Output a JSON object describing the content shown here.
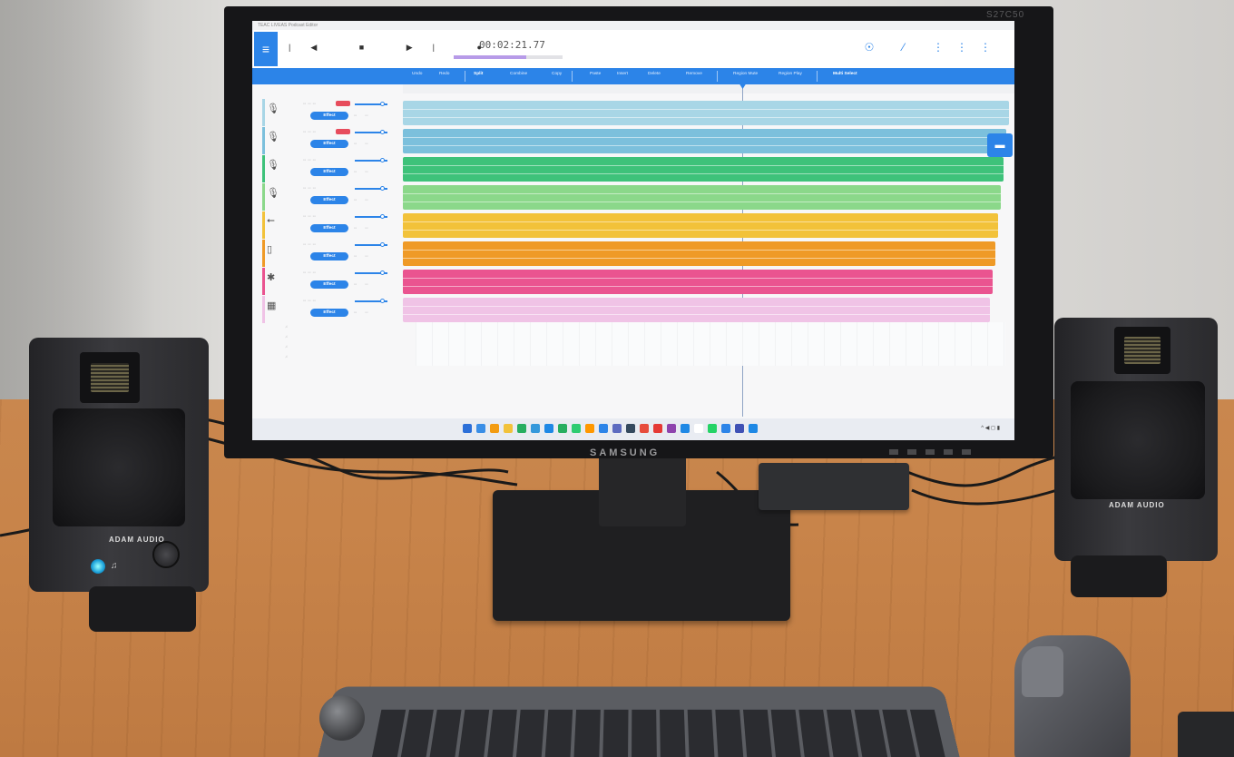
{
  "app": {
    "window_title": "TEAC LIVEAS Podcast Editor",
    "timecode": "00:02:21.77",
    "menu_glyph": "≡",
    "transport_glyphs": "|◀ ■ ▶| ●",
    "top_icon_glyphs": "☉ ⁄ ⋮⋮⋮",
    "toolbar": [
      "Undo",
      "Redo",
      "Split",
      "Combine",
      "Copy",
      "Paste",
      "Insert",
      "Delete",
      "Remove",
      "Region Mute",
      "Region Play",
      "Multi Select"
    ],
    "effect_label": "Effect",
    "folder_glyph": "▬",
    "track_icons": [
      "🎙",
      "🎙",
      "🎙",
      "🎙",
      "⭠",
      "▯",
      "✱",
      "▦"
    ],
    "track_colors": [
      "#a8d6e6",
      "#7cc0dc",
      "#3ec27a",
      "#8bd88a",
      "#f2c23a",
      "#ef9a27",
      "#ea5490",
      "#f0c3e6"
    ],
    "empty_track_glyph": "♫"
  },
  "monitor": {
    "brand": "SAMSUNG",
    "model_tag": "S27C50"
  },
  "speakers": {
    "brand": "ADAM AUDIO"
  },
  "colors": {
    "accent": "#2c84e8",
    "desk": "#c8844a",
    "wall": "#e0dfdc"
  }
}
